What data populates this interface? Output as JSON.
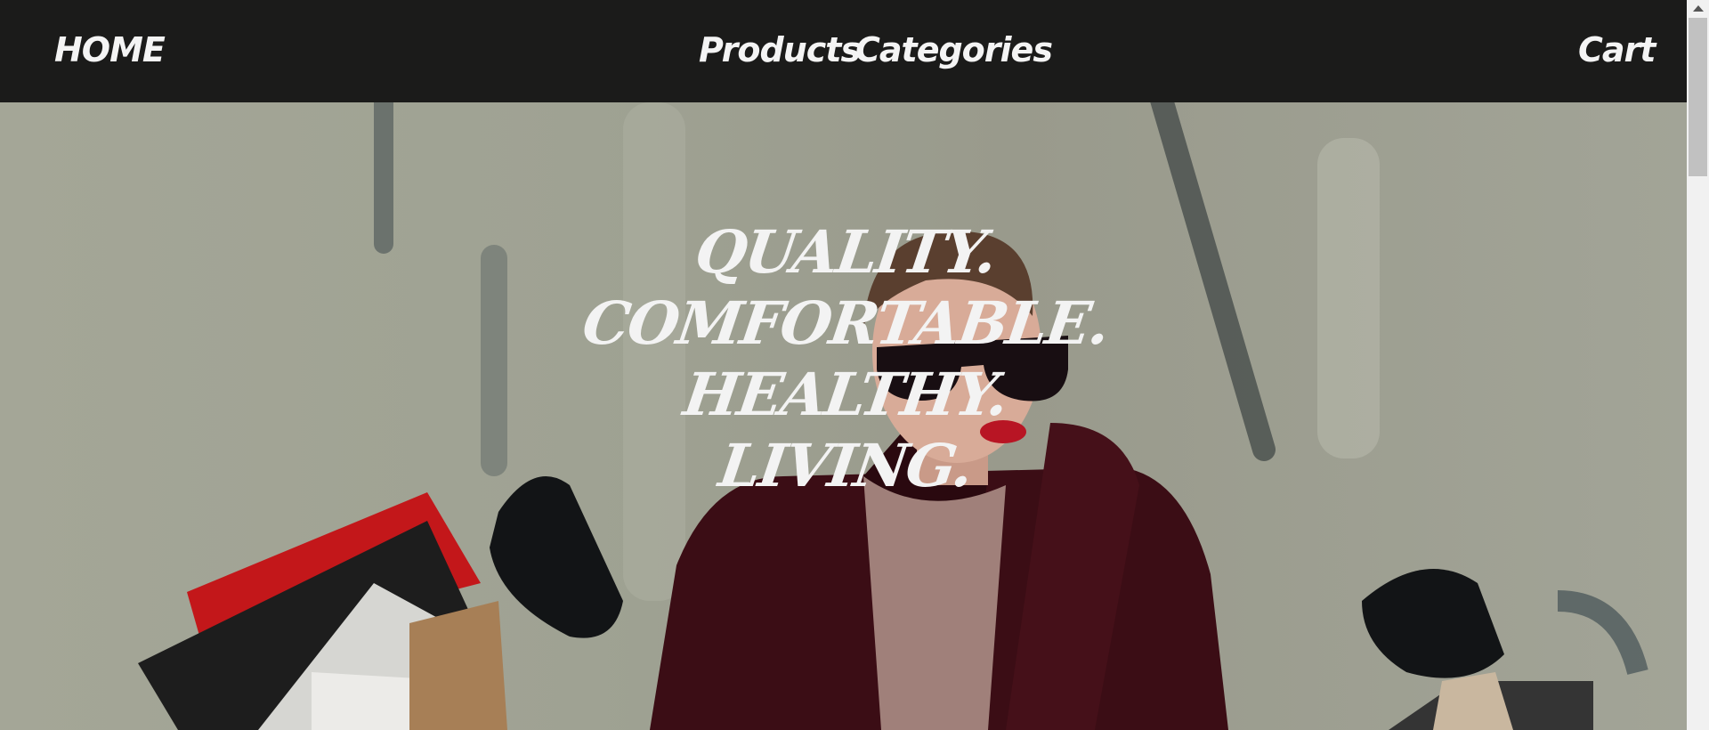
{
  "nav": {
    "home": "HOME",
    "products": "Products",
    "categories": "Categories",
    "cart": "Cart"
  },
  "hero": {
    "tagline": [
      "Quality.",
      "Comfortable.",
      "Healthy.",
      "Living."
    ]
  }
}
